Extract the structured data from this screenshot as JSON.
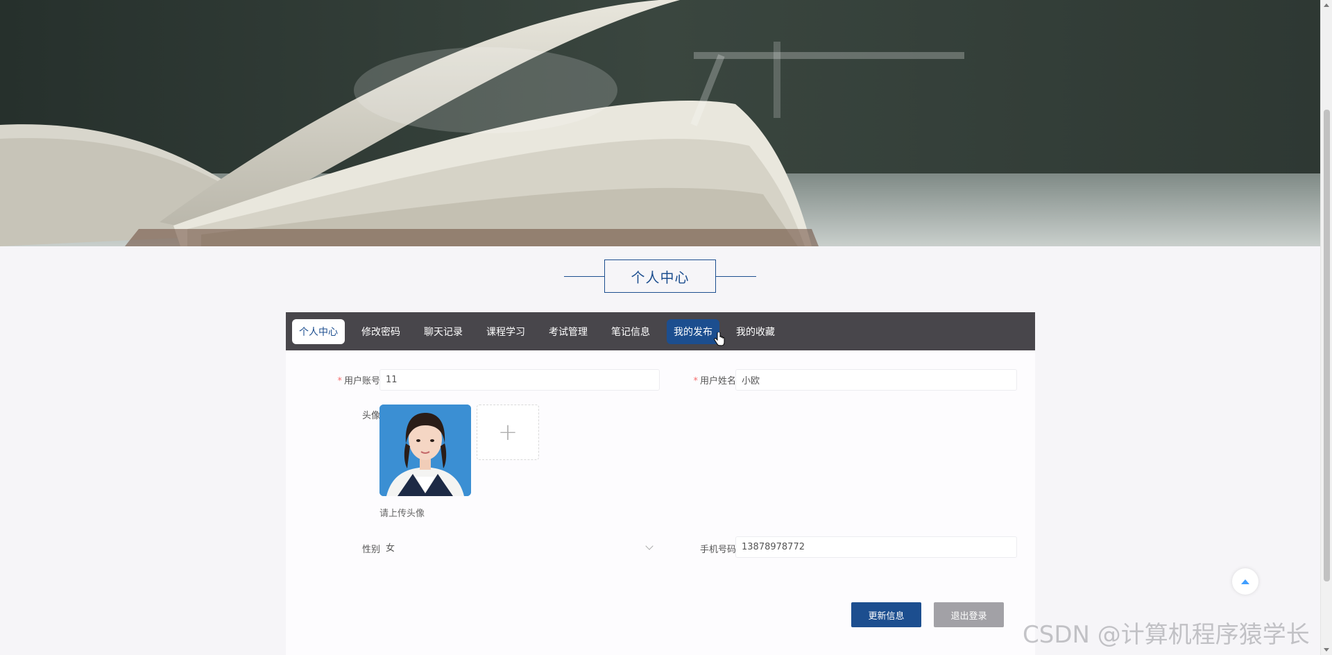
{
  "section_title": "个人中心",
  "tabs": [
    {
      "label": "个人中心",
      "state": "current"
    },
    {
      "label": "修改密码",
      "state": "normal"
    },
    {
      "label": "聊天记录",
      "state": "normal"
    },
    {
      "label": "课程学习",
      "state": "normal"
    },
    {
      "label": "考试管理",
      "state": "normal"
    },
    {
      "label": "笔记信息",
      "state": "normal"
    },
    {
      "label": "我的发布",
      "state": "hover"
    },
    {
      "label": "我的收藏",
      "state": "normal"
    }
  ],
  "form": {
    "account": {
      "label": "用户账号",
      "value": "11",
      "required": true
    },
    "name": {
      "label": "用户姓名",
      "value": "小欧",
      "required": true
    },
    "avatar": {
      "label": "头像",
      "hint": "请上传头像",
      "upload_symbol": "+"
    },
    "gender": {
      "label": "性别",
      "value": "女"
    },
    "phone": {
      "label": "手机号码",
      "value": "13878978772"
    },
    "required_mark": "*"
  },
  "buttons": {
    "update": "更新信息",
    "logout": "退出登录"
  },
  "watermark": "CSDN @计算机程序猿学长",
  "colors": {
    "accent": "#1c4e8f",
    "tabbar_bg": "#48464b",
    "secondary_button": "#a2a1a6",
    "required": "#f56c6c"
  },
  "icons": {
    "back_to_top": "arrow-up-icon",
    "select": "chevron-down-icon",
    "upload": "plus-icon"
  }
}
